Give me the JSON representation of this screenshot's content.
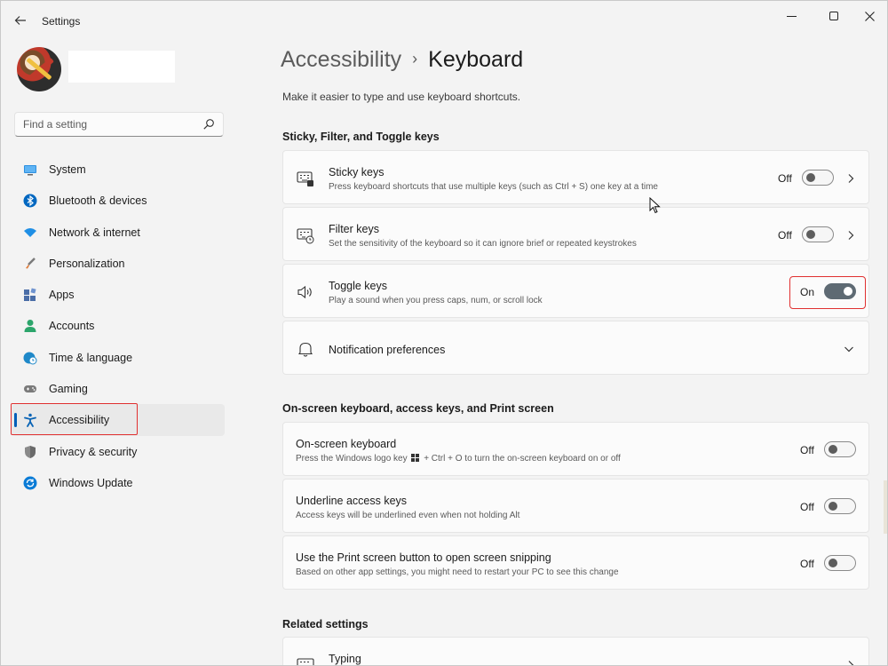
{
  "window": {
    "title": "Settings",
    "back_icon": "arrow-left-icon"
  },
  "search": {
    "placeholder": "Find a setting",
    "icon": "search-icon"
  },
  "sidebar": {
    "items": [
      {
        "label": "System",
        "icon": "monitor-icon",
        "color": "#0078d4"
      },
      {
        "label": "Bluetooth & devices",
        "icon": "bluetooth-icon",
        "color": "#0067c0"
      },
      {
        "label": "Network & internet",
        "icon": "wifi-icon",
        "color": "#1f8fe5"
      },
      {
        "label": "Personalization",
        "icon": "brush-icon",
        "color": "#e07b39"
      },
      {
        "label": "Apps",
        "icon": "apps-icon",
        "color": "#4a6da7"
      },
      {
        "label": "Accounts",
        "icon": "person-icon",
        "color": "#2ca56b"
      },
      {
        "label": "Time & language",
        "icon": "globe-clock-icon",
        "color": "#1e88c8"
      },
      {
        "label": "Gaming",
        "icon": "gamepad-icon",
        "color": "#6d6d6d"
      },
      {
        "label": "Accessibility",
        "icon": "accessibility-icon",
        "color": "#0a64b5",
        "selected": true
      },
      {
        "label": "Privacy & security",
        "icon": "shield-icon",
        "color": "#707070"
      },
      {
        "label": "Windows Update",
        "icon": "update-icon",
        "color": "#0a7bd6"
      }
    ]
  },
  "header": {
    "parent": "Accessibility",
    "current": "Keyboard",
    "description": "Make it easier to type and use keyboard shortcuts."
  },
  "sections": {
    "sticky": {
      "title": "Sticky, Filter, and Toggle keys",
      "items": [
        {
          "title": "Sticky keys",
          "desc": "Press keyboard shortcuts that use multiple keys (such as Ctrl + S) one key at a time",
          "state": "Off",
          "on": false
        },
        {
          "title": "Filter keys",
          "desc": "Set the sensitivity of the keyboard so it can ignore brief or repeated keystrokes",
          "state": "Off",
          "on": false
        },
        {
          "title": "Toggle keys",
          "desc": "Play a sound when you press caps, num, or scroll lock",
          "state": "On",
          "on": true
        }
      ],
      "notification": {
        "title": "Notification preferences"
      }
    },
    "onscreen": {
      "title": "On-screen keyboard, access keys, and Print screen",
      "items": [
        {
          "title": "On-screen keyboard",
          "desc_before": "Press the Windows logo key",
          "desc_after": "+ Ctrl + O to turn the on-screen keyboard on or off",
          "state": "Off",
          "on": false
        },
        {
          "title": "Underline access keys",
          "desc": "Access keys will be underlined even when not holding Alt",
          "state": "Off",
          "on": false
        },
        {
          "title": "Use the Print screen button to open screen snipping",
          "desc": "Based on other app settings, you might need to restart your PC to see this change",
          "state": "Off",
          "on": false
        }
      ]
    },
    "related": {
      "title": "Related settings",
      "items": [
        {
          "title": "Typing"
        }
      ]
    }
  },
  "colors": {
    "accent": "#005fb8",
    "highlight": "#e03030",
    "toggle_on": "#5e6a73"
  }
}
